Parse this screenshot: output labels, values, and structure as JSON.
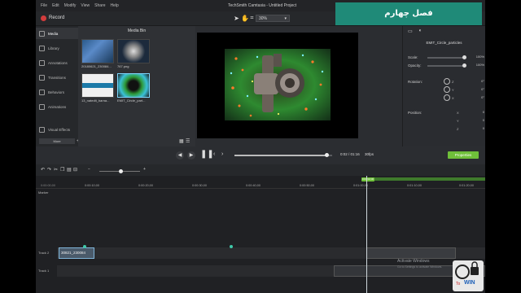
{
  "app": {
    "title": "TechSmith Camtasia - Untitled Project",
    "menus": [
      "File",
      "Edit",
      "Modify",
      "View",
      "Share",
      "Help"
    ],
    "record_label": "Record",
    "zoom_level": "30%"
  },
  "sidebar": {
    "items": [
      {
        "label": "Media",
        "active": true
      },
      {
        "label": "Library"
      },
      {
        "label": "Annotations"
      },
      {
        "label": "Transitions"
      },
      {
        "label": "Behaviors"
      },
      {
        "label": "Animations"
      },
      {
        "label": "Visual Effects"
      }
    ],
    "more_label": "More"
  },
  "media_bin": {
    "title": "Media Bin",
    "items": [
      {
        "label": "20180621_230084..."
      },
      {
        "label": "767.png"
      },
      {
        "label": "13_natedit_barna..."
      },
      {
        "label": "EMIT_Circle_part..."
      }
    ]
  },
  "properties": {
    "clip_name": "EMIT_Circle_particles",
    "scale_label": "Scale:",
    "scale_value": "100%",
    "scale_level": 1.0,
    "opacity_label": "Opacity:",
    "opacity_value": "100%",
    "opacity_level": 1.0,
    "rotation_label": "Rotation:",
    "rotation": [
      {
        "axis": "Z",
        "value": "0°"
      },
      {
        "axis": "Y",
        "value": "0°"
      },
      {
        "axis": "X",
        "value": "0°"
      }
    ],
    "position_label": "Position:",
    "position": [
      {
        "axis": "X",
        "value": "0"
      },
      {
        "axis": "Y",
        "value": "0"
      },
      {
        "axis": "Z",
        "value": "0"
      }
    ],
    "button_label": "Properties"
  },
  "player": {
    "timecode": "0:02 / 01:16",
    "fps": "30fps",
    "progress": 0.95
  },
  "timeline": {
    "ticks": [
      "0:00:00;00",
      "0:00:10;00",
      "0:00:20;00",
      "0:00:30;00",
      "0:00:40;00",
      "0:00:50;00",
      "0:01:00;00",
      "0:01:10;00",
      "0:01:20;00"
    ],
    "playhead_label": "0:01:02;00",
    "marker_label": "Marker",
    "tracks": [
      {
        "name": "Track 2",
        "clip": "30821_230084"
      },
      {
        "name": "Track 1",
        "clip": ""
      }
    ]
  },
  "watermark": {
    "line1": "Activate Windows",
    "line2": "Go to Settings to activate Windows."
  },
  "overlay": {
    "badge_text": "فصل چهارم"
  },
  "logo": {
    "to_text": "To",
    "win_text": "WIN"
  },
  "colors": {
    "accent_green": "#6fbf3a",
    "badge_teal": "#1f8a78",
    "selected_border": "#7fd8ff"
  }
}
